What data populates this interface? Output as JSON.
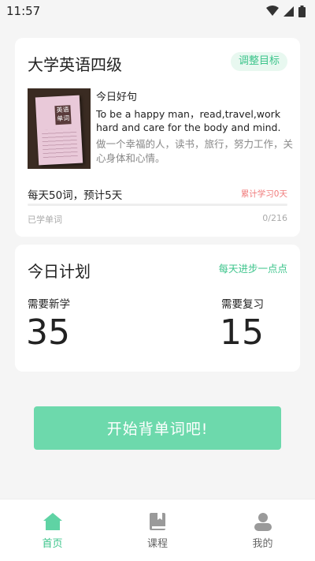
{
  "status": {
    "time": "11:57"
  },
  "book": {
    "title": "大学英语四级",
    "adjust_label": "调整目标",
    "cover_label": "英语单词"
  },
  "quote": {
    "heading": "今日好句",
    "english": "To be a happy man，read,travel,work hard and care for the body and mind.",
    "chinese": "做一个幸福的人，读书，旅行，努力工作，关心身体和心情。"
  },
  "progress": {
    "plan_text": "每天50词，预计5天",
    "cumulative_text": "累计学习0天",
    "learned_label": "已学单词",
    "learned_count": "0/216",
    "fraction": 0
  },
  "plan": {
    "title": "今日计划",
    "slogan": "每天进步一点点",
    "new_label": "需要新学",
    "new_count": "35",
    "review_label": "需要复习",
    "review_count": "15"
  },
  "start_button": {
    "label": "开始背单词吧!"
  },
  "nav": {
    "items": [
      {
        "label": "首页",
        "icon": "home-icon",
        "active": true
      },
      {
        "label": "课程",
        "icon": "book-icon",
        "active": false
      },
      {
        "label": "我的",
        "icon": "profile-icon",
        "active": false
      }
    ]
  },
  "colors": {
    "accent": "#3cc48b",
    "button": "#6dd9ac",
    "warning": "#f07a7a"
  }
}
